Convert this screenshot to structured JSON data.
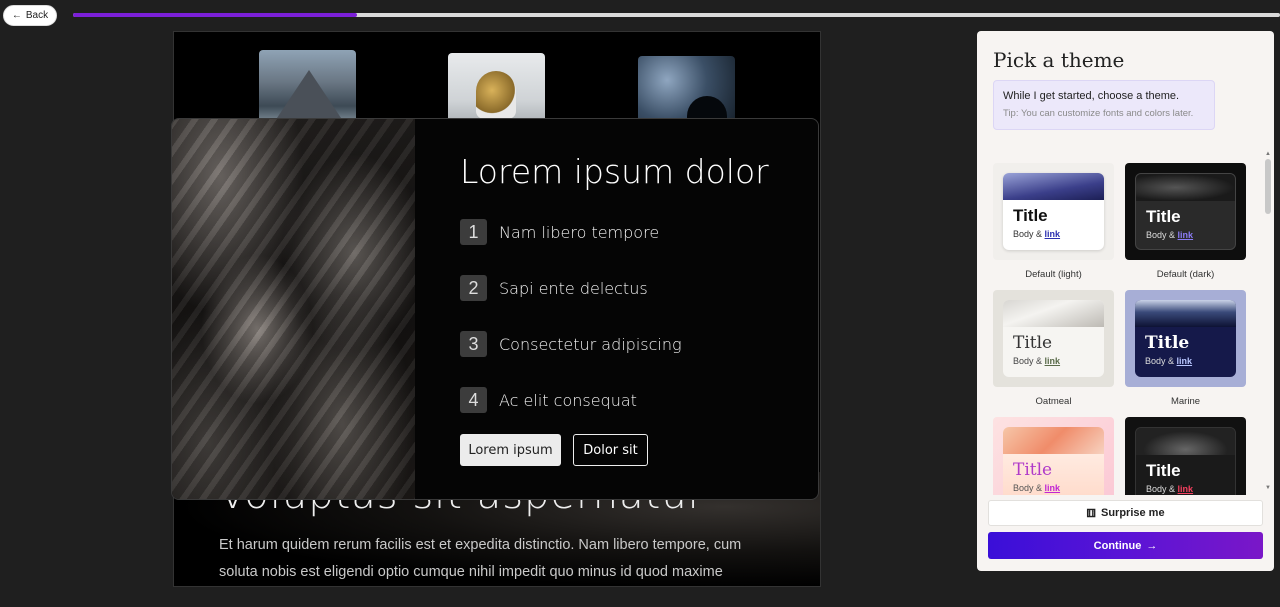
{
  "topbar": {
    "back_label": "Back",
    "back_icon": "arrow-left-icon",
    "progress_fraction": 0.235
  },
  "preview": {
    "overlay": {
      "title": "Lorem ipsum dolor",
      "items": [
        {
          "num": "1",
          "text": "Nam libero tempore"
        },
        {
          "num": "2",
          "text": "Sapi ente delectus"
        },
        {
          "num": "3",
          "text": "Consectetur adipiscing"
        },
        {
          "num": "4",
          "text": "Ac elit consequat"
        }
      ],
      "primary_button": "Lorem ipsum",
      "secondary_button": "Dolor sit"
    },
    "background_heading": "Voluptas sit aspernatur",
    "background_body": "Et harum quidem rerum facilis est et expedita distinctio. Nam libero tempore, cum soluta nobis est eligendi optio cumque nihil impedit quo minus id quod maxime"
  },
  "panel": {
    "title": "Pick a theme",
    "tip_main": "While I get started, choose a theme.",
    "tip_sub": "Tip: You can customize fonts and colors later.",
    "themes": [
      {
        "name": "Default (light)",
        "title": "Title",
        "body": "Body &",
        "link": "link",
        "link_color": "#2a2fb0"
      },
      {
        "name": "Default (dark)",
        "title": "Title",
        "body": "Body &",
        "link": "link",
        "link_color": "#8b7cf6"
      },
      {
        "name": "Oatmeal",
        "title": "Title",
        "body": "Body &",
        "link": "link",
        "link_color": "#5a6b4a"
      },
      {
        "name": "Marine",
        "title": "Title",
        "body": "Body &",
        "link": "link",
        "link_color": "#b8c6ff"
      },
      {
        "name": "",
        "title": "Title",
        "body": "Body &",
        "link": "link",
        "link_color": "#c026d3"
      },
      {
        "name": "",
        "title": "Title",
        "body": "Body &",
        "link": "link",
        "link_color": "#f43f5e"
      }
    ],
    "surprise_label": "Surprise me",
    "surprise_icon": "dice-icon",
    "continue_label": "Continue",
    "continue_icon": "arrow-right-icon"
  },
  "colors": {
    "accent": "#5a14d6",
    "progress": "#7b1fd8"
  }
}
